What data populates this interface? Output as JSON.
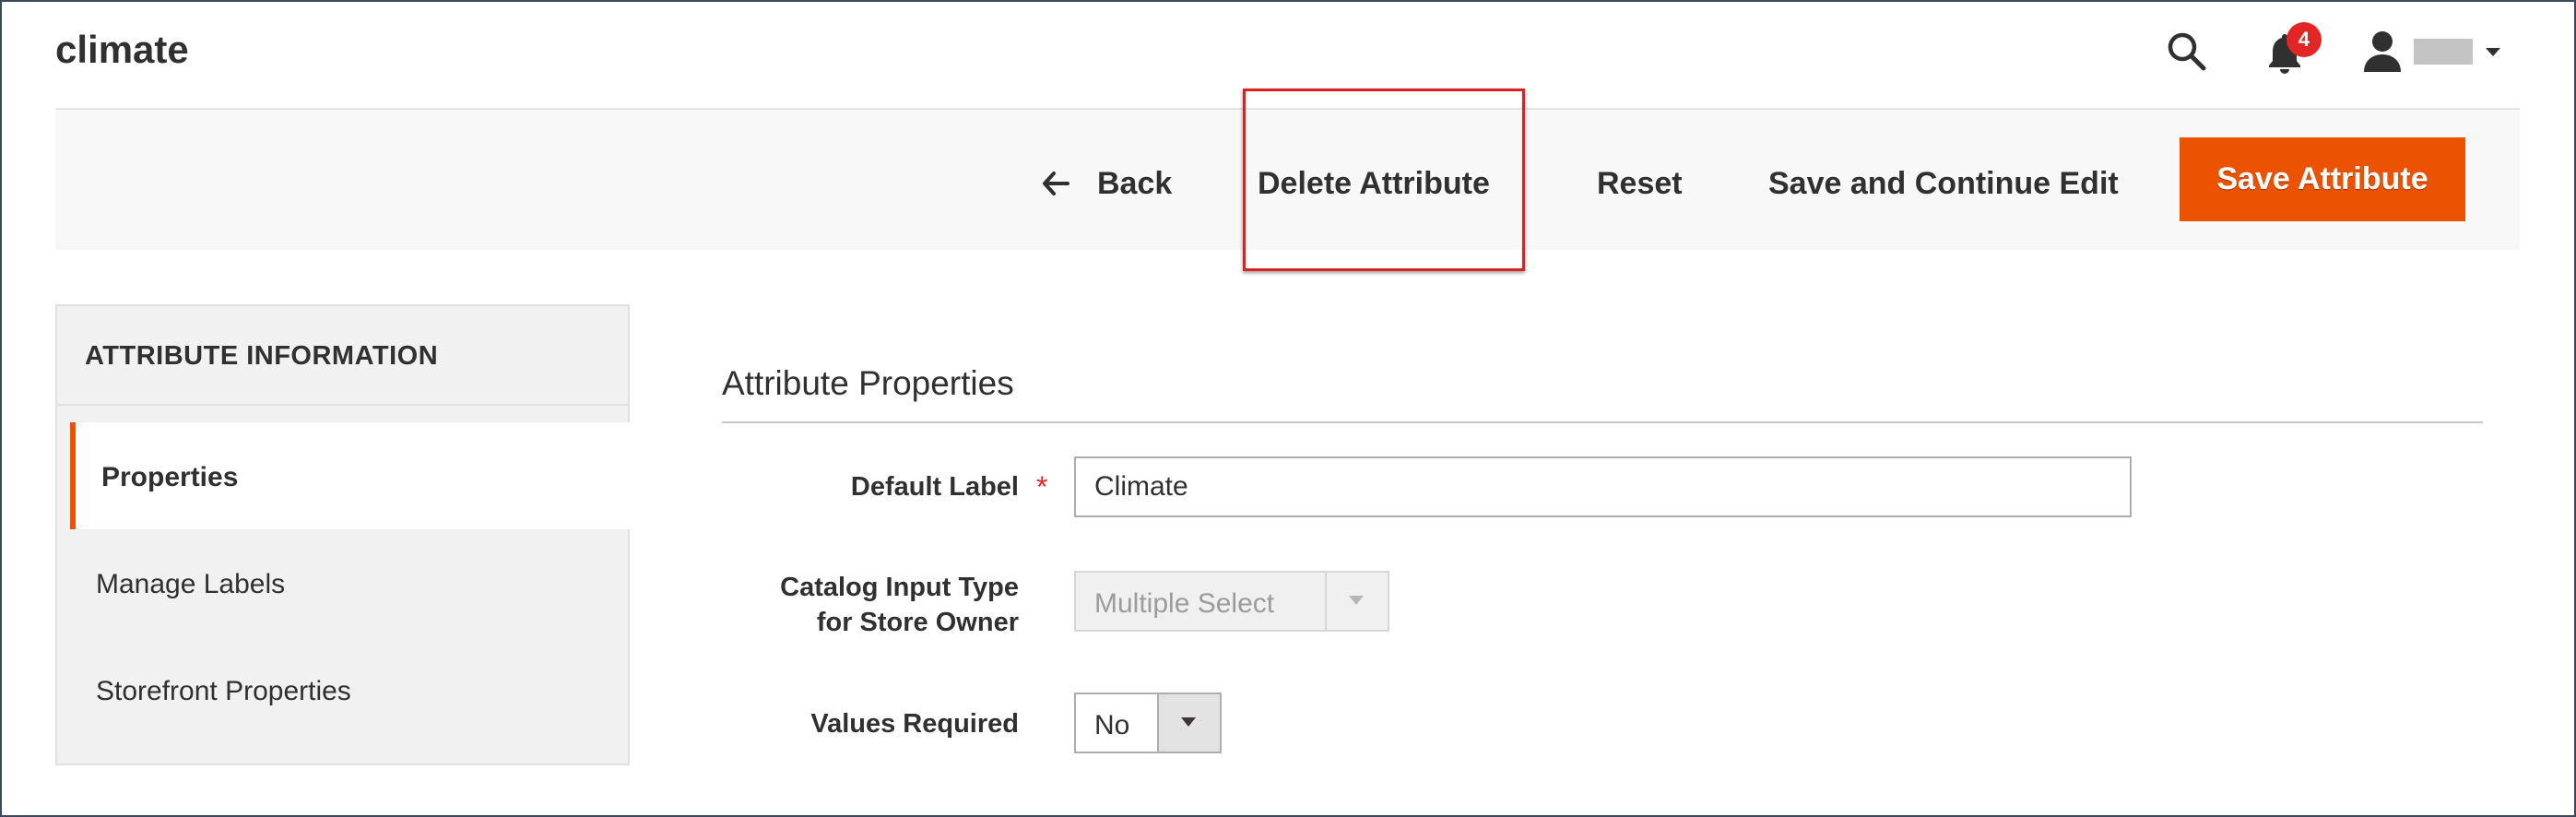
{
  "page": {
    "title": "climate"
  },
  "header": {
    "notifications_count": "4",
    "icons": [
      "search-icon",
      "bell-icon",
      "user-icon",
      "caret-down-icon"
    ]
  },
  "actions": {
    "back": "Back",
    "delete": "Delete Attribute",
    "reset": "Reset",
    "save_continue": "Save and Continue Edit",
    "save": "Save Attribute"
  },
  "sidebar": {
    "title": "ATTRIBUTE INFORMATION",
    "tabs": [
      {
        "label": "Properties",
        "active": true
      },
      {
        "label": "Manage Labels",
        "active": false
      },
      {
        "label": "Storefront Properties",
        "active": false
      }
    ]
  },
  "form": {
    "section_title": "Attribute Properties",
    "default_label": {
      "label": "Default Label",
      "value": "Climate",
      "required": true
    },
    "input_type": {
      "label_line1": "Catalog Input Type",
      "label_line2": "for Store Owner",
      "value": "Multiple Select",
      "disabled": true
    },
    "values_required": {
      "label": "Values Required",
      "value": "No"
    }
  },
  "colors": {
    "accent": "#eb5202",
    "badge": "#e22626",
    "highlight": "#e02020"
  }
}
